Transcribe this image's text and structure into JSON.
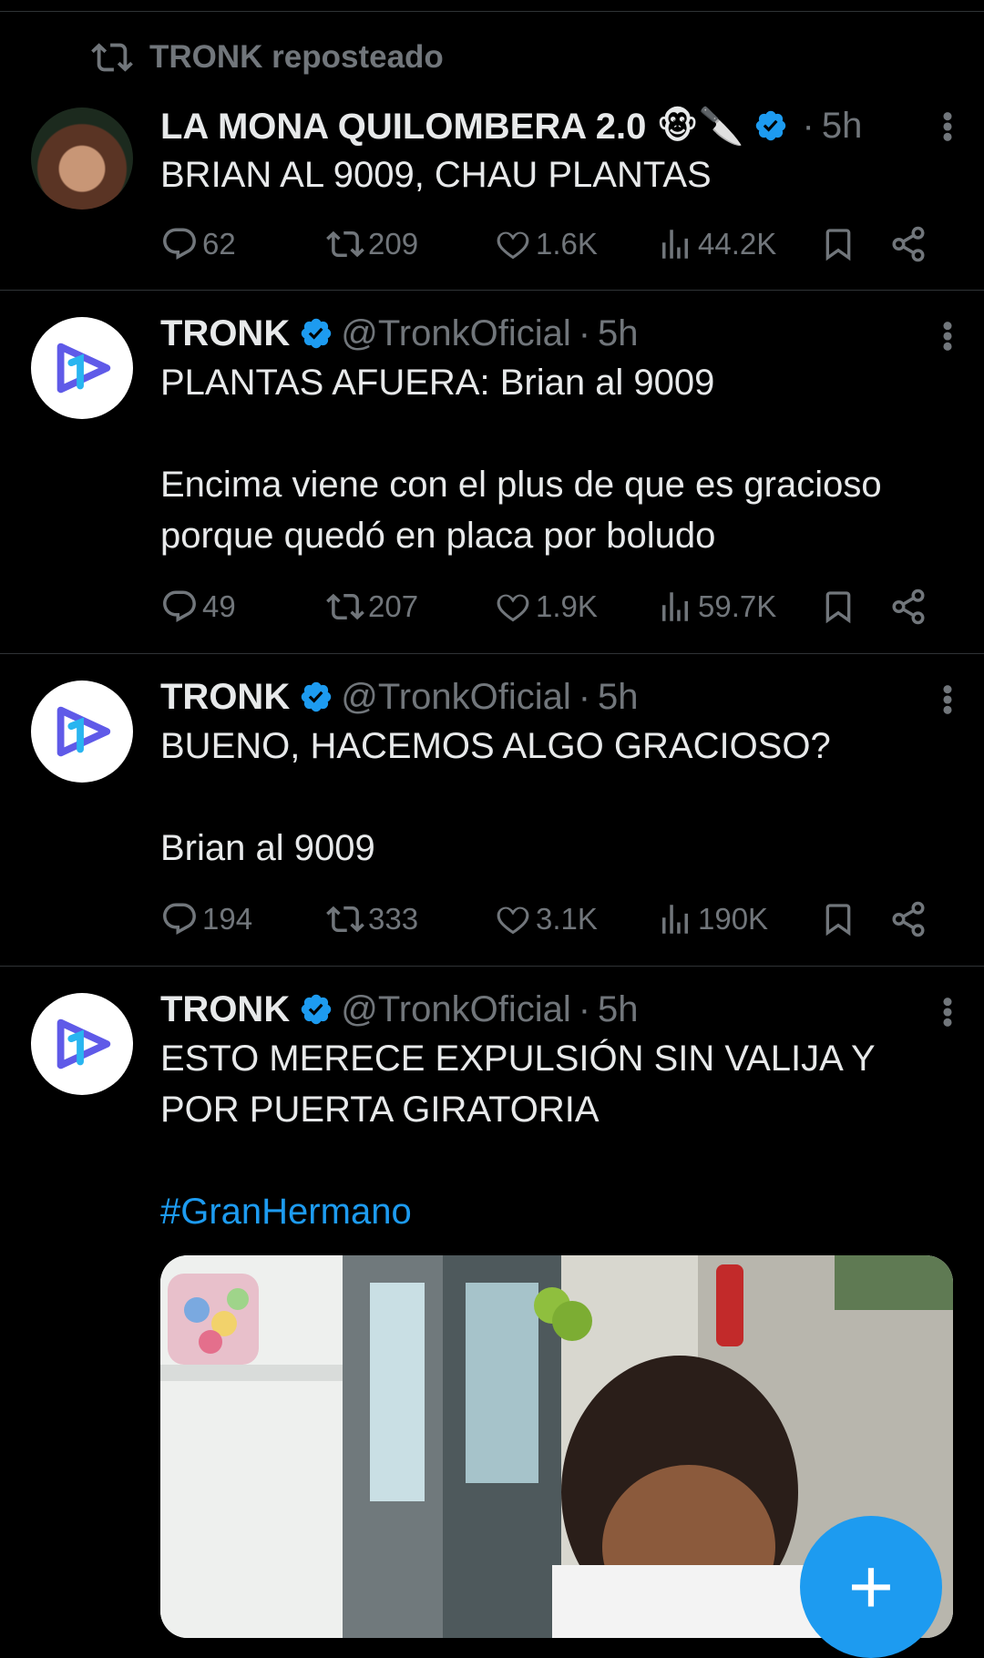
{
  "repost": {
    "label": "TRONK reposteado"
  },
  "tweets": [
    {
      "name": "LA MONA QUILOMBERA 2.0 🐵🔪",
      "handle": "",
      "time": "5h",
      "text": "BRIAN AL 9009, CHAU PLANTAS",
      "replies": "62",
      "retweets": "209",
      "likes": "1.6K",
      "views": "44.2K"
    },
    {
      "name": "TRONK",
      "handle": "@TronkOficial",
      "time": "5h",
      "text": "PLANTAS AFUERA: Brian al 9009\n\nEncima viene con el plus de que es gracioso porque quedó en placa por boludo",
      "replies": "49",
      "retweets": "207",
      "likes": "1.9K",
      "views": "59.7K"
    },
    {
      "name": "TRONK",
      "handle": "@TronkOficial",
      "time": "5h",
      "text": "BUENO, HACEMOS ALGO GRACIOSO?\n\nBrian al 9009",
      "replies": "194",
      "retweets": "333",
      "likes": "3.1K",
      "views": "190K"
    },
    {
      "name": "TRONK",
      "handle": "@TronkOficial",
      "time": "5h",
      "text": "ESTO MERECE EXPULSIÓN SIN VALIJA Y POR PUERTA GIRATORIA",
      "hashtag": "#GranHermano"
    }
  ],
  "fab": {
    "icon": "plus-icon",
    "label": "+"
  },
  "colors": {
    "background": "#000000",
    "text": "#e7e9ea",
    "secondary": "#71767b",
    "accent": "#1d9bf0"
  }
}
